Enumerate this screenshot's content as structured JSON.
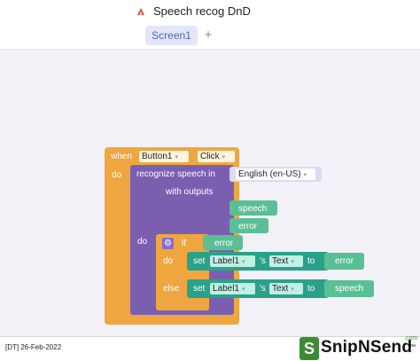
{
  "app": {
    "title": "Speech recog DnD"
  },
  "tabs": {
    "screen": "Screen1",
    "add": "+"
  },
  "blocks": {
    "event": {
      "when": "when",
      "component": "Button1",
      "event": "Click",
      "do": "do"
    },
    "recognize": {
      "label": "recognize speech in",
      "language": "English (en-US)",
      "with_outputs": "with outputs",
      "speech": "speech",
      "error": "error",
      "do": "do"
    },
    "if_block": {
      "if": "if",
      "condition": "error",
      "do": "do",
      "else": "else"
    },
    "set1": {
      "set": "set",
      "component": "Label1",
      "possessive": "'s",
      "property": "Text",
      "to": "to",
      "value": "error"
    },
    "set2": {
      "set": "set",
      "component": "Label1",
      "possessive": "'s",
      "property": "Text",
      "to": "to",
      "value": "speech"
    }
  },
  "footer": {
    "date": "[DT] 26-Feb-2022",
    "logo_main": "SnipNSend",
    "logo_tm": "™",
    "logo_com": ".com"
  },
  "icons": {
    "app": "app-logo-icon",
    "gear": "gear-icon",
    "dropdown": "dropdown-caret-icon"
  },
  "colors": {
    "event": "#f0a640",
    "procedure": "#7a5fb0",
    "variable": "#5bbf95",
    "setter": "#2aa189"
  }
}
